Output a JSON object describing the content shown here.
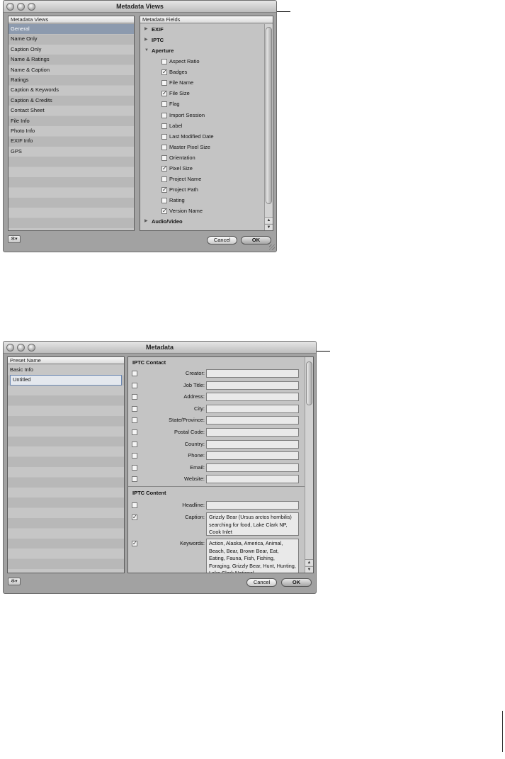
{
  "window1": {
    "title": "Metadata Views",
    "views_header": "Metadata Views",
    "views": [
      "General",
      "Name Only",
      "Caption Only",
      "Name & Ratings",
      "Name & Caption",
      "Ratings",
      "Caption & Keywords",
      "Caption & Credits",
      "Contact Sheet",
      "File Info",
      "Photo Info",
      "EXIF Info",
      "GPS"
    ],
    "selected_view": "General",
    "fields_header": "Metadata Fields",
    "cat_exif": "EXIF",
    "cat_iptc": "IPTC",
    "cat_aperture": "Aperture",
    "cat_audio": "Audio/Video",
    "aperture_fields": [
      {
        "label": "Aspect Ratio",
        "checked": false
      },
      {
        "label": "Badges",
        "checked": true
      },
      {
        "label": "File Name",
        "checked": false
      },
      {
        "label": "File Size",
        "checked": true
      },
      {
        "label": "Flag",
        "checked": false
      },
      {
        "label": "Import Session",
        "checked": false
      },
      {
        "label": "Label",
        "checked": false
      },
      {
        "label": "Last Modified Date",
        "checked": false
      },
      {
        "label": "Master Pixel Size",
        "checked": false
      },
      {
        "label": "Orientation",
        "checked": false
      },
      {
        "label": "Pixel Size",
        "checked": true
      },
      {
        "label": "Project Name",
        "checked": false
      },
      {
        "label": "Project Path",
        "checked": true
      },
      {
        "label": "Rating",
        "checked": false
      },
      {
        "label": "Version Name",
        "checked": true
      }
    ],
    "cancel_label": "Cancel",
    "ok_label": "OK"
  },
  "window2": {
    "title": "Metadata",
    "preset_header": "Preset Name",
    "presets": [
      "Basic Info",
      "Untitled"
    ],
    "selected_preset": "Untitled",
    "contact_head": "IPTC Contact",
    "contact_fields": [
      {
        "label": "Creator:",
        "value": "",
        "checked": false
      },
      {
        "label": "Job Title:",
        "value": "",
        "checked": false
      },
      {
        "label": "Address:",
        "value": "",
        "checked": false
      },
      {
        "label": "City:",
        "value": "",
        "checked": false
      },
      {
        "label": "State/Province:",
        "value": "",
        "checked": false
      },
      {
        "label": "Postal Code:",
        "value": "",
        "checked": false
      },
      {
        "label": "Country:",
        "value": "",
        "checked": false
      },
      {
        "label": "Phone:",
        "value": "",
        "checked": false
      },
      {
        "label": "Email:",
        "value": "",
        "checked": false
      },
      {
        "label": "Website:",
        "value": "",
        "checked": false
      }
    ],
    "content_head": "IPTC Content",
    "headline_label": "Headline:",
    "headline_value": "",
    "headline_checked": false,
    "caption_label": "Caption:",
    "caption_value": "Grizzly Bear (Ursus arctos horribilis) searching for food, Lake Clark NP, Cook Inlet",
    "caption_checked": true,
    "keywords_label": "Keywords:",
    "keywords_value": "Action, Alaska, America, Animal, Beach, Bear, Brown Bear, Eat, Eating, Fauna, Fish, Fishing, Foraging, Grizzly Bear, Hunt, Hunting, Lake Clark National",
    "keywords_checked": true,
    "cancel_label": "Cancel",
    "ok_label": "OK"
  },
  "icons": {
    "checkmark": "✓",
    "arrow_right": "▶",
    "arrow_down": "▼",
    "arrow_up": "▲",
    "gear": "✻▾"
  }
}
